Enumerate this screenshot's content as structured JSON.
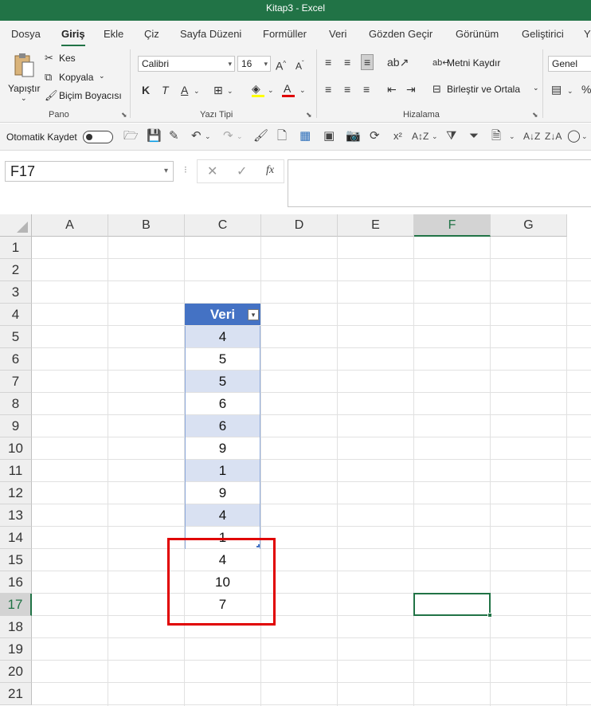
{
  "window": {
    "title": "Kitap3  -  Excel"
  },
  "menu": {
    "tabs": [
      "Dosya",
      "Giriş",
      "Ekle",
      "Çiz",
      "Sayfa Düzeni",
      "Formüller",
      "Veri",
      "Gözden Geçir",
      "Görünüm",
      "Geliştirici",
      "Y"
    ],
    "active": "Giriş"
  },
  "ribbon": {
    "clipboard": {
      "paste_label": "Yapıştır",
      "cut_label": "Kes",
      "copy_label": "Kopyala",
      "format_painter_label": "Biçim Boyacısı",
      "group_label": "Pano"
    },
    "font": {
      "font_name": "Calibri",
      "font_size": "16",
      "bold": "K",
      "italic": "T",
      "underline": "A",
      "group_label": "Yazı Tipi"
    },
    "alignment": {
      "wrap_label": "Metni Kaydır",
      "merge_label": "Birleştir ve Ortala",
      "group_label": "Hizalama"
    },
    "number": {
      "format": "Genel"
    }
  },
  "quick_access": {
    "autosave_label": "Otomatik Kaydet"
  },
  "formula_bar": {
    "name_box": "F17",
    "formula": ""
  },
  "columns": [
    "A",
    "B",
    "C",
    "D",
    "E",
    "F",
    "G"
  ],
  "rows": [
    "1",
    "2",
    "3",
    "4",
    "5",
    "6",
    "7",
    "8",
    "9",
    "10",
    "11",
    "12",
    "13",
    "14",
    "15",
    "16",
    "17",
    "18",
    "19",
    "20",
    "21"
  ],
  "selected_cell": "F17",
  "table": {
    "header": "Veri",
    "values": [
      "4",
      "5",
      "5",
      "6",
      "6",
      "9",
      "1",
      "9",
      "4",
      "1"
    ]
  },
  "extra_values": [
    "4",
    "10",
    "7"
  ],
  "colors": {
    "accent": "#217346",
    "table_header": "#4472c4",
    "table_band": "#d9e1f2",
    "highlight": "#e00000"
  }
}
